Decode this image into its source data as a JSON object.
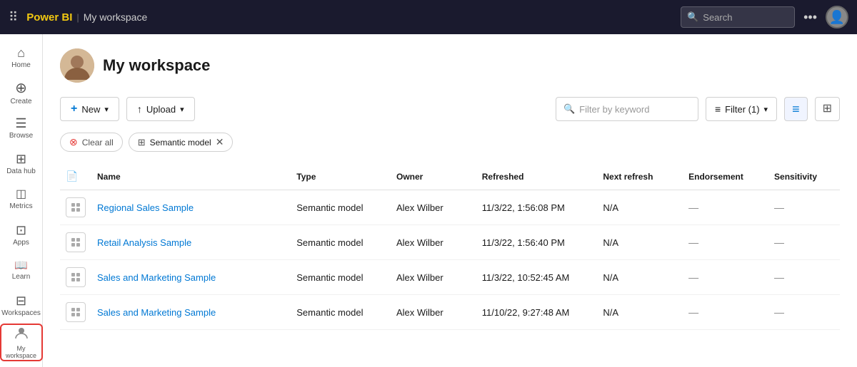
{
  "topbar": {
    "app_name": "Power BI",
    "workspace_name": "My workspace",
    "search_placeholder": "Search",
    "more_icon": "•••"
  },
  "sidebar": {
    "items": [
      {
        "id": "home",
        "label": "Home",
        "icon": "⌂"
      },
      {
        "id": "create",
        "label": "Create",
        "icon": "+"
      },
      {
        "id": "browse",
        "label": "Browse",
        "icon": "☰"
      },
      {
        "id": "data-hub",
        "label": "Data hub",
        "icon": "⊞"
      },
      {
        "id": "metrics",
        "label": "Metrics",
        "icon": "◫"
      },
      {
        "id": "apps",
        "label": "Apps",
        "icon": "⊡"
      },
      {
        "id": "learn",
        "label": "Learn",
        "icon": "📖"
      },
      {
        "id": "workspaces",
        "label": "Workspaces",
        "icon": "⊟"
      },
      {
        "id": "my-workspace",
        "label": "My workspace",
        "icon": "👤",
        "active": true
      }
    ]
  },
  "workspace": {
    "title": "My workspace"
  },
  "toolbar": {
    "new_label": "New",
    "upload_label": "Upload",
    "filter_placeholder": "Filter by keyword",
    "filter_label": "Filter (1)",
    "view_list_icon": "≡",
    "view_split_icon": "⊞"
  },
  "filter_tags": {
    "clear_label": "Clear all",
    "tags": [
      {
        "label": "Semantic model"
      }
    ]
  },
  "table": {
    "columns": [
      "Name",
      "Type",
      "Owner",
      "Refreshed",
      "Next refresh",
      "Endorsement",
      "Sensitivity"
    ],
    "rows": [
      {
        "name": "Regional Sales Sample",
        "type": "Semantic model",
        "owner": "Alex Wilber",
        "refreshed": "11/3/22, 1:56:08 PM",
        "next_refresh": "N/A",
        "endorsement": "—",
        "sensitivity": "—"
      },
      {
        "name": "Retail Analysis Sample",
        "type": "Semantic model",
        "owner": "Alex Wilber",
        "refreshed": "11/3/22, 1:56:40 PM",
        "next_refresh": "N/A",
        "endorsement": "—",
        "sensitivity": "—"
      },
      {
        "name": "Sales and Marketing Sample",
        "type": "Semantic model",
        "owner": "Alex Wilber",
        "refreshed": "11/3/22, 10:52:45 AM",
        "next_refresh": "N/A",
        "endorsement": "—",
        "sensitivity": "—"
      },
      {
        "name": "Sales and Marketing Sample",
        "type": "Semantic model",
        "owner": "Alex Wilber",
        "refreshed": "11/10/22, 9:27:48 AM",
        "next_refresh": "N/A",
        "endorsement": "—",
        "sensitivity": "—"
      }
    ]
  }
}
